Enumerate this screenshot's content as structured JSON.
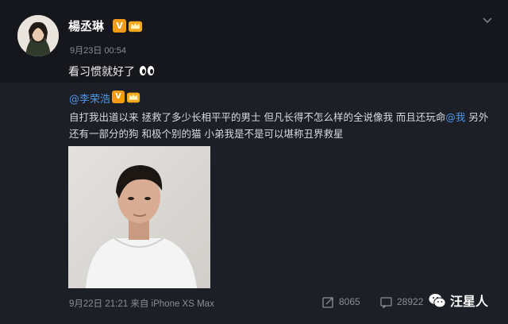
{
  "post": {
    "author": "楊丞琳",
    "vip": "V",
    "timestamp": "9月23日 00:54",
    "text": "看习惯就好了"
  },
  "repost": {
    "author": "@李荣浩",
    "vip": "V",
    "text_part1": "自打我出道以来 拯救了多少长相平平的男士 但凡长得不怎么样的全说像我 而且还玩命",
    "mention": "@我",
    "text_part2": " 另外还有一部分的狗 和极个别的猫 小弟我是不是可以堪称丑界救星",
    "meta": "9月22日 21:21 来自 iPhone XS Max",
    "shares": "8065",
    "comments": "28922"
  },
  "watermark": {
    "text": "汪星人"
  },
  "colors": {
    "background": "#15171c",
    "repost_background": "#1c1f26",
    "link": "#4e95e6",
    "vip_badge": "#f29b13"
  }
}
